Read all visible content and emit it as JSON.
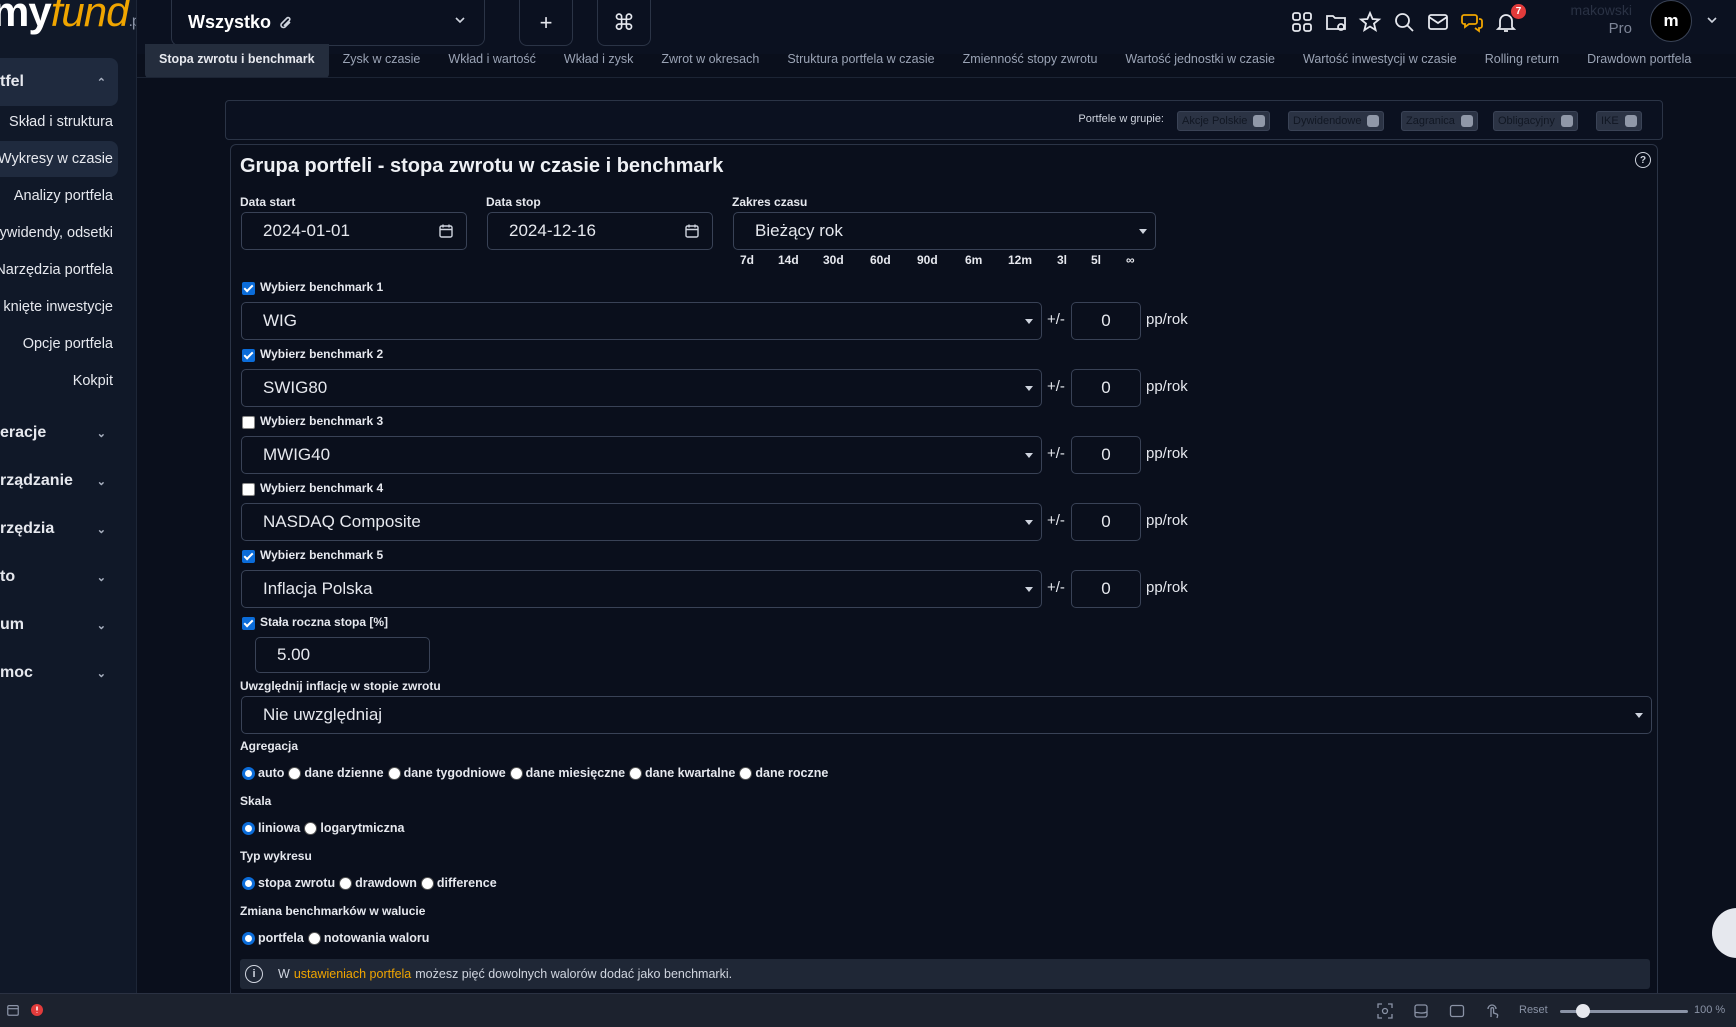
{
  "brand": {
    "my": "my",
    "fund": "fund",
    "pl": ".pl"
  },
  "sidebar": {
    "portfolio_title": "tfel",
    "items": [
      {
        "label": "Skład i struktura"
      },
      {
        "label": "Wykresy w czasie"
      },
      {
        "label": "Analizy portfela"
      },
      {
        "label": "ywidendy, odsetki"
      },
      {
        "label": "Narzędzia portfela"
      },
      {
        "label": "knięte inwestycje"
      },
      {
        "label": "Opcje portfela"
      },
      {
        "label": "Kokpit"
      }
    ],
    "sections": [
      {
        "label": "eracje"
      },
      {
        "label": "rządzanie"
      },
      {
        "label": "rzędzia"
      },
      {
        "label": "to"
      },
      {
        "label": "um"
      },
      {
        "label": "moc"
      }
    ]
  },
  "topbar": {
    "portfolio_select": "Wszystko",
    "add_label": "+",
    "cmd_label": "⌘",
    "notifications_count": "7",
    "user_name": "makowski",
    "user_plan": "Pro",
    "avatar_letter": "m"
  },
  "tabs": [
    {
      "label": "Stopa zwrotu i benchmark"
    },
    {
      "label": "Zysk w czasie"
    },
    {
      "label": "Wkład i wartość"
    },
    {
      "label": "Wkład i zysk"
    },
    {
      "label": "Zwrot w okresach"
    },
    {
      "label": "Struktura portfela w czasie"
    },
    {
      "label": "Zmienność stopy zwrotu"
    },
    {
      "label": "Wartość jednostki w czasie"
    },
    {
      "label": "Wartość inwestycji w czasie"
    },
    {
      "label": "Rolling return"
    },
    {
      "label": "Drawdown portfela"
    }
  ],
  "group": {
    "label": "Portfele w grupie:",
    "chips": [
      {
        "label": "Akcje Polskie"
      },
      {
        "label": "Dywidendowe"
      },
      {
        "label": "Zagranica"
      },
      {
        "label": "Obligacyjny"
      },
      {
        "label": "IKE"
      }
    ]
  },
  "panel": {
    "title": "Grupa portfeli - stopa zwrotu w czasie i benchmark",
    "help": "?",
    "date_start_label": "Data start",
    "date_start": "2024-01-01",
    "date_stop_label": "Data stop",
    "date_stop": "2024-12-16",
    "range_label": "Zakres czasu",
    "range_value": "Bieżący rok",
    "quick_ranges": [
      "7d",
      "14d",
      "30d",
      "60d",
      "90d",
      "6m",
      "12m",
      "3l",
      "5l",
      "∞"
    ],
    "benchmarks": [
      {
        "label": "Wybierz benchmark 1",
        "checked": true,
        "value": "WIG",
        "pm": "+/-",
        "offset": "0",
        "unit": "pp/rok"
      },
      {
        "label": "Wybierz benchmark 2",
        "checked": true,
        "value": "SWIG80",
        "pm": "+/-",
        "offset": "0",
        "unit": "pp/rok"
      },
      {
        "label": "Wybierz benchmark 3",
        "checked": false,
        "value": "MWIG40",
        "pm": "+/-",
        "offset": "0",
        "unit": "pp/rok"
      },
      {
        "label": "Wybierz benchmark 4",
        "checked": false,
        "value": "NASDAQ Composite",
        "pm": "+/-",
        "offset": "0",
        "unit": "pp/rok"
      },
      {
        "label": "Wybierz benchmark 5",
        "checked": true,
        "value": "Inflacja Polska",
        "pm": "+/-",
        "offset": "0",
        "unit": "pp/rok"
      }
    ],
    "fixed_rate_label": "Stała roczna stopa [%]",
    "fixed_rate_checked": true,
    "fixed_rate_value": "5.00",
    "inflation_label": "Uwzględnij inflację w stopie zwrotu",
    "inflation_value": "Nie uwzględniaj",
    "aggregation_label": "Agregacja",
    "aggregation_options": [
      "auto",
      "dane dzienne",
      "dane tygodniowe",
      "dane miesięczne",
      "dane kwartalne",
      "dane roczne"
    ],
    "aggregation_selected": "auto",
    "scale_label": "Skala",
    "scale_options": [
      "liniowa",
      "logarytmiczna"
    ],
    "scale_selected": "liniowa",
    "chart_type_label": "Typ wykresu",
    "chart_type_options": [
      "stopa zwrotu",
      "drawdown",
      "difference"
    ],
    "chart_type_selected": "stopa zwrotu",
    "currency_label": "Zmiana benchmarków w walucie",
    "currency_options": [
      "portfela",
      "notowania waloru"
    ],
    "currency_selected": "portfela",
    "info_prefix": "W",
    "info_link": "ustawieniach portfela",
    "info_suffix": "możesz pięć dowolnych walorów dodać jako benchmarki."
  },
  "footer": {
    "reset_label": "Reset",
    "zoom": "100 %",
    "zoom_level": 0.18
  },
  "colors": {
    "accent": "#0b6cd9",
    "brand_orange": "#f0a500",
    "background": "#0a0f1c",
    "sidebar": "#101828",
    "badge": "#e23b3b"
  }
}
